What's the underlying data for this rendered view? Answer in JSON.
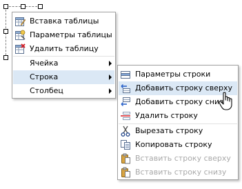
{
  "table_menu": {
    "items": [
      {
        "label": "Вставка таблицы",
        "icon": "insert-table-icon"
      },
      {
        "label": "Параметры таблицы",
        "icon": "table-properties-icon"
      },
      {
        "label": "Удалить таблицу",
        "icon": "delete-table-icon"
      },
      {
        "label": "Ячейка",
        "submenu": true
      },
      {
        "label": "Строка",
        "submenu": true,
        "highlighted": true
      },
      {
        "label": "Столбец",
        "submenu": true
      }
    ]
  },
  "row_submenu": {
    "items": [
      {
        "label": "Параметры строки",
        "icon": "row-properties-icon"
      },
      {
        "label": "Добавить строку сверху",
        "icon": "insert-row-above-icon",
        "highlighted": true
      },
      {
        "label": "Добавить строку снизу",
        "icon": "insert-row-below-icon"
      },
      {
        "label": "Удалить строку",
        "icon": "delete-row-icon"
      },
      {
        "label": "Вырезать строку",
        "icon": "cut-icon"
      },
      {
        "label": "Копировать строку",
        "icon": "copy-icon"
      },
      {
        "label": "Вставить строку сверху",
        "icon": "paste-icon",
        "disabled": true
      },
      {
        "label": "Вставить строку снизу",
        "icon": "paste-icon",
        "disabled": true
      }
    ]
  },
  "colors": {
    "highlight": "#dbe8f5",
    "disabled_text": "#a9a9a9",
    "border": "#a0a0a0"
  }
}
